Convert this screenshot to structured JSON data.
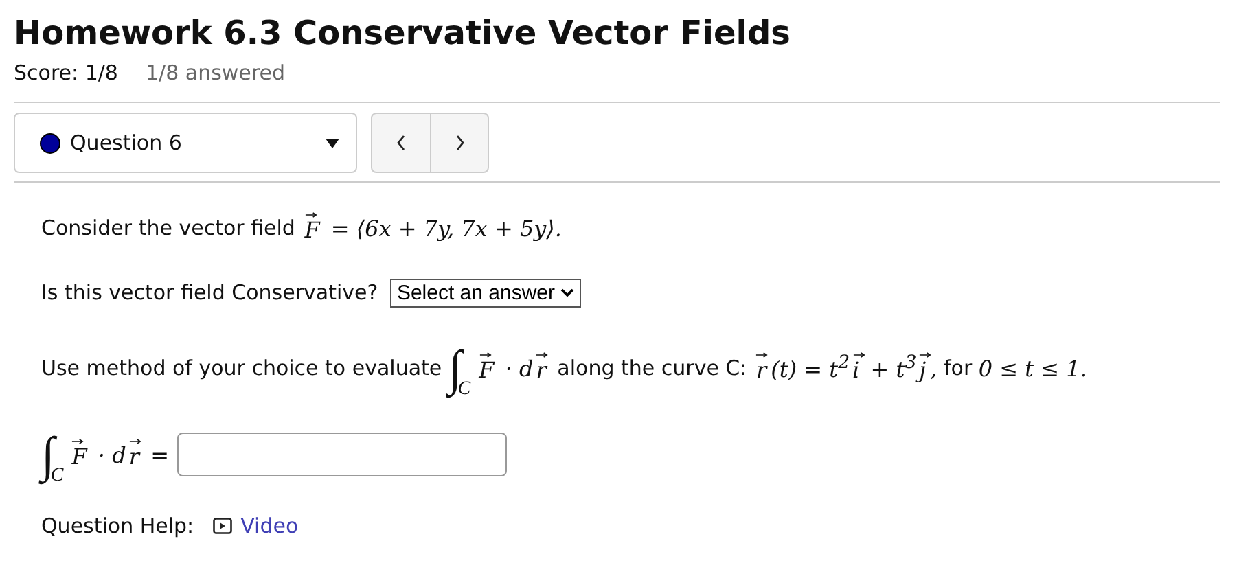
{
  "header": {
    "title": "Homework 6.3 Conservative Vector Fields",
    "score": "Score: 1/8",
    "answered": "1/8 answered"
  },
  "navigation": {
    "question": {
      "label": "Question 6",
      "color": "#000099"
    }
  },
  "question": {
    "parts": [
      {
        "kind": "text",
        "segments": [
          {
            "kind": "text",
            "text": "Consider the vector field "
          },
          {
            "kind": "vector",
            "text": "F"
          },
          {
            "kind": "math",
            "text": " = ⟨6x + 7y, 7x + 5y⟩."
          }
        ]
      },
      {
        "kind": "text",
        "segments": [
          {
            "kind": "text",
            "text": "Is this vector field Conservative? "
          },
          {
            "kind": "select",
            "text": "Select an answer"
          }
        ]
      },
      {
        "kind": "text",
        "segments": [
          {
            "kind": "text",
            "text": "Use method of your choice to evaluate "
          },
          {
            "kind": "integral",
            "symbol": "∫",
            "sub": "C"
          },
          {
            "kind": "vector",
            "text": "F"
          },
          {
            "kind": "math",
            "text": " · d"
          },
          {
            "kind": "vector",
            "text": "r"
          },
          {
            "kind": "text",
            "text": " along the curve C: "
          },
          {
            "kind": "vector",
            "text": "r"
          },
          {
            "kind": "math",
            "text": "(t) = t$^{2}$"
          },
          {
            "kind": "vector",
            "text": "i"
          },
          {
            "kind": "math",
            "text": " + t$^{3}$"
          },
          {
            "kind": "vector",
            "text": "j"
          },
          {
            "kind": "math",
            "text": ","
          },
          {
            "kind": "text",
            "text": " for "
          },
          {
            "kind": "math",
            "text": "0 ≤ t ≤ 1."
          }
        ]
      },
      {
        "kind": "answer",
        "segments": [
          {
            "kind": "integral",
            "symbol": "∫",
            "sub": "C"
          },
          {
            "kind": "vector",
            "text": "F"
          },
          {
            "kind": "math",
            "text": " · d"
          },
          {
            "kind": "vector",
            "text": "r"
          },
          {
            "kind": "math",
            "text": " ="
          },
          {
            "kind": "input"
          }
        ]
      }
    ],
    "help": {
      "label": "Question Help:",
      "link": "Video"
    }
  }
}
